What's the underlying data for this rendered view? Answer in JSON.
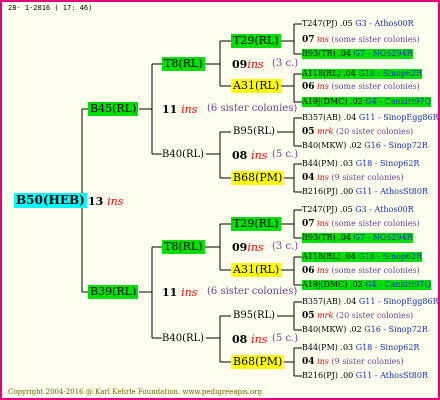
{
  "date": "28- 1-2016 ( 17: 46)",
  "copyright": "Copyright 2004-2016 @ Karl Kehrle Foundation.   www.pedigreeapis.org",
  "root": {
    "label": "B50(HEB)",
    "num": "13",
    "ins": "ins"
  },
  "branches": [
    {
      "label": "B45(RL)",
      "num": "11",
      "ins": "ins",
      "note": "(6 sister colonies)",
      "children": [
        {
          "label": "T8(RL)",
          "subs": [
            {
              "label": "T29(RL)",
              "num": "09",
              "ins": "ins",
              "note": "(3 c.)",
              "leaves": [
                {
                  "name": "T247(PJ) .05",
                  "code": "G3 - Athos00R",
                  "green": false
                },
                {
                  "name": "07",
                  "ins": "ins",
                  "desc": "(some sister colonies)",
                  "mini": true
                },
                {
                  "name": "B93(TR) .04",
                  "code": "G7 - NO6294R",
                  "green": true
                }
              ]
            },
            {
              "label": "A31(RL)",
              "num": "",
              "ins": "",
              "note": "",
              "leaves": [
                {
                  "name": "A118(RL) .04",
                  "code": "G18 - Sinop62R",
                  "green": true
                },
                {
                  "name": "06",
                  "ins": "ins",
                  "desc": "(some sister colonies)",
                  "mini": true
                },
                {
                  "name": "A19j(DMC) .02",
                  "code": "G4 - Cankiri97Q",
                  "green": true
                }
              ]
            }
          ]
        },
        {
          "label": "B40(RL)",
          "subs": [
            {
              "label": "B95(RL)",
              "num": "08",
              "ins": "ins",
              "note": "(5 c.)",
              "leaves": [
                {
                  "name": "B357(AB) .04",
                  "code": "G11 - SinopEgg86R",
                  "green": false
                },
                {
                  "name": "05",
                  "ins": "mrk",
                  "desc": "(20 sister colonies)",
                  "mini": true
                },
                {
                  "name": "B40(MKW) .02",
                  "code": "G16 - Sinop72R",
                  "green": false
                }
              ]
            },
            {
              "label": "B68(PM)",
              "num": "",
              "ins": "",
              "note": "",
              "leaves": [
                {
                  "name": "B44(PM) .03",
                  "code": "G18 - Sinop62R",
                  "green": false
                },
                {
                  "name": "04",
                  "ins": "ins",
                  "desc": "(9 sister colonies)",
                  "mini": true
                },
                {
                  "name": "B216(PJ) .00",
                  "code": "G11 - AthosSt80R",
                  "green": false
                }
              ]
            }
          ]
        }
      ]
    },
    {
      "label": "B39(RL)",
      "num": "11",
      "ins": "ins",
      "note": "(6 sister colonies)",
      "children": [
        {
          "label": "T8(RL)",
          "subs": [
            {
              "label": "T29(RL)",
              "num": "09",
              "ins": "ins",
              "note": "(3 c.)",
              "leaves": [
                {
                  "name": "T247(PJ) .05",
                  "code": "G3 - Athos00R",
                  "green": false
                },
                {
                  "name": "07",
                  "ins": "ins",
                  "desc": "(some sister colonies)",
                  "mini": true
                },
                {
                  "name": "B93(TR) .04",
                  "code": "G7 - NO6294R",
                  "green": true
                }
              ]
            },
            {
              "label": "A31(RL)",
              "num": "",
              "ins": "",
              "note": "",
              "leaves": [
                {
                  "name": "A118(RL) .04",
                  "code": "G18 - Sinop62R",
                  "green": true
                },
                {
                  "name": "06",
                  "ins": "ins",
                  "desc": "(some sister colonies)",
                  "mini": true
                },
                {
                  "name": "A19j(DMC) .02",
                  "code": "G4 - Cankiri97Q",
                  "green": true
                }
              ]
            }
          ]
        },
        {
          "label": "B40(RL)",
          "subs": [
            {
              "label": "B95(RL)",
              "num": "08",
              "ins": "ins",
              "note": "(5 c.)",
              "leaves": [
                {
                  "name": "B357(AB) .04",
                  "code": "G11 - SinopEgg86R",
                  "green": false
                },
                {
                  "name": "05",
                  "ins": "mrk",
                  "desc": "(20 sister colonies)",
                  "mini": true
                },
                {
                  "name": "B40(MKW) .02",
                  "code": "G16 - Sinop72R",
                  "green": false
                }
              ]
            },
            {
              "label": "B68(PM)",
              "num": "",
              "ins": "",
              "note": "",
              "leaves": [
                {
                  "name": "B44(PM) .03",
                  "code": "G18 - Sinop62R",
                  "green": false
                },
                {
                  "name": "04",
                  "ins": "ins",
                  "desc": "(9 sister colonies)",
                  "mini": true
                },
                {
                  "name": "B216(PJ) .00",
                  "code": "G11 - AthosSt80R",
                  "green": false
                }
              ]
            }
          ]
        }
      ]
    }
  ],
  "colors": {
    "border": "#e8007a",
    "green": "#00e000",
    "yellow": "#ffff00",
    "cyan": "#00ffff",
    "ins": "#ff0000"
  }
}
